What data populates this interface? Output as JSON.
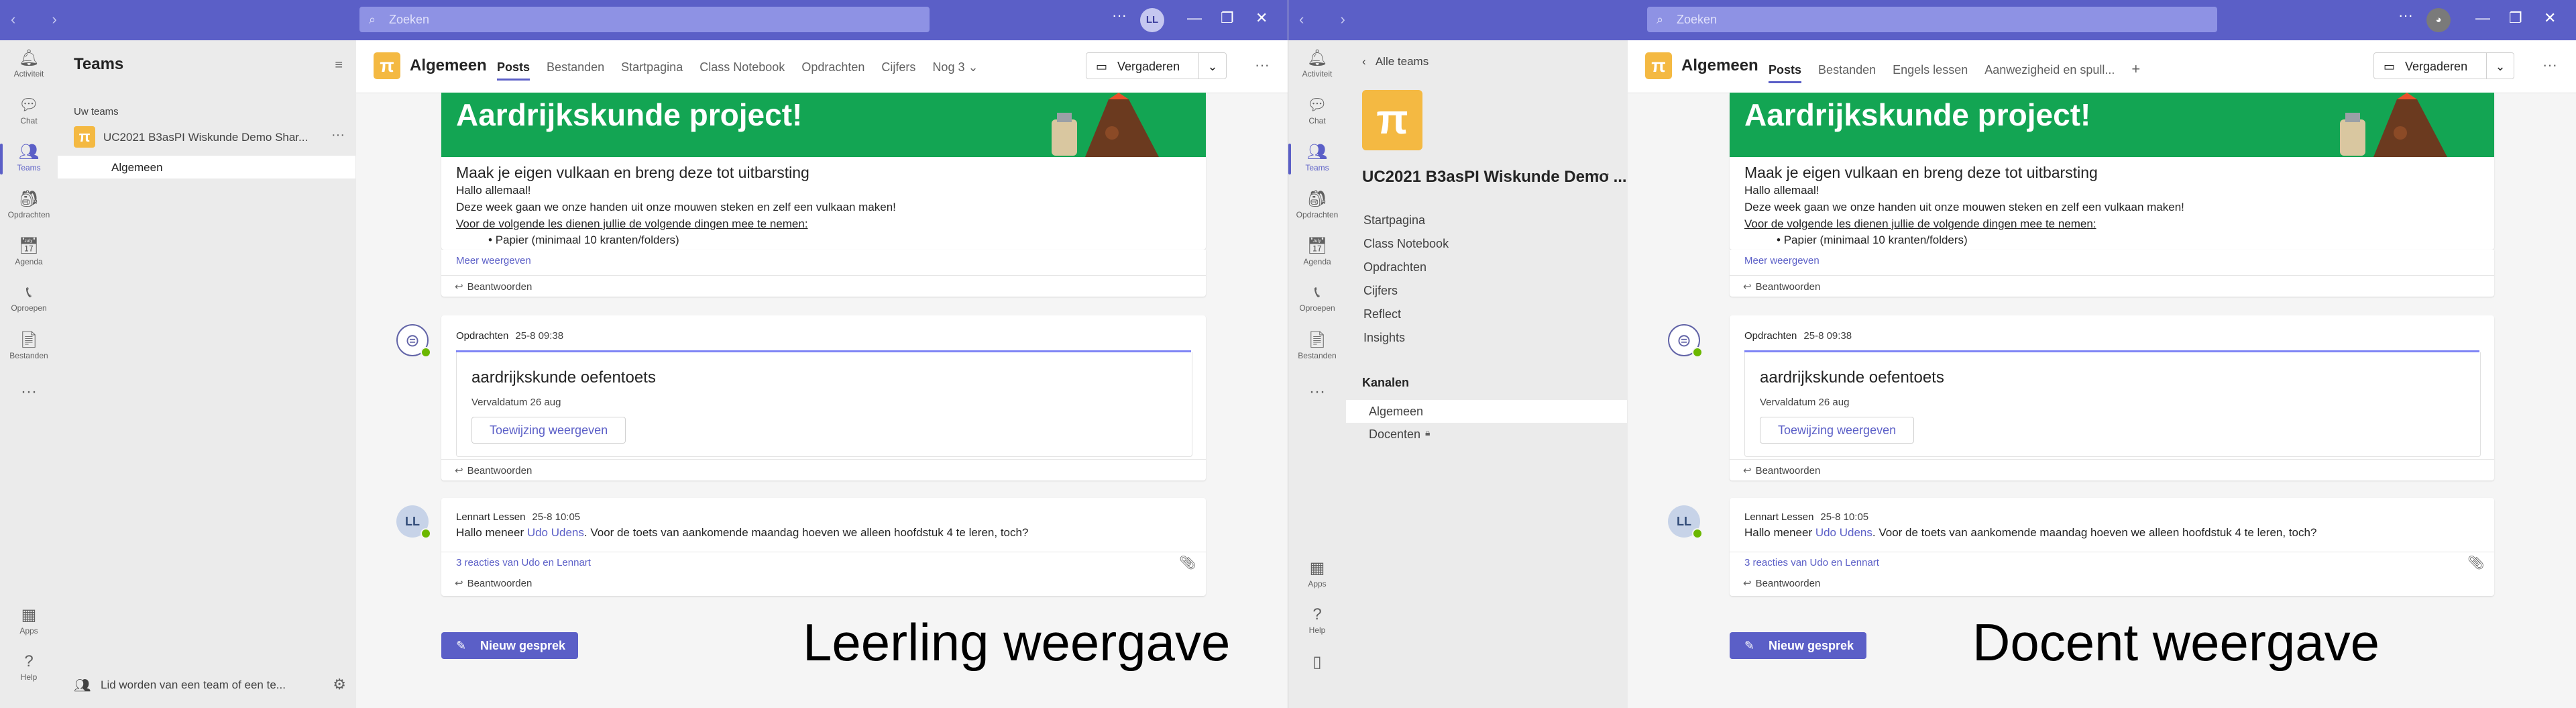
{
  "common": {
    "search_placeholder": "Zoeken",
    "search_icon": "search-icon",
    "avatar_initials": "LL",
    "rail": [
      {
        "label": "Activiteit",
        "icon": "bell-icon"
      },
      {
        "label": "Chat",
        "icon": "chat-icon"
      },
      {
        "label": "Teams",
        "icon": "teams-icon"
      },
      {
        "label": "Opdrachten",
        "icon": "assignments-icon"
      },
      {
        "label": "Agenda",
        "icon": "calendar-icon"
      },
      {
        "label": "Oproepen",
        "icon": "phone-icon"
      },
      {
        "label": "Bestanden",
        "icon": "file-icon"
      }
    ],
    "rail_more": "···",
    "rail_bottom": [
      {
        "label": "Apps",
        "icon": "apps-icon"
      },
      {
        "label": "Help",
        "icon": "help-icon"
      }
    ],
    "channel_title": "Algemeen",
    "meet_label": "Vergaderen",
    "banner_title": "Aardrijkskunde project!",
    "post": {
      "heading": "Maak je eigen vulkaan en breng deze tot uitbarsting",
      "line1": "Hallo allemaal!",
      "line2": "Deze week gaan we onze handen uit onze mouwen steken en zelf een vulkaan maken!",
      "line3": "Voor de volgende les dienen jullie de volgende dingen mee te nemen:",
      "bullet": "Papier (minimaal 10 kranten/folders)",
      "more": "Meer weergeven"
    },
    "reply_label": "Beantwoorden",
    "assignment": {
      "author": "Opdrachten",
      "time": "25-8 09:38",
      "title": "aardrijkskunde oefentoets",
      "due": "Vervaldatum 26 aug",
      "button": "Toewijzing weergeven"
    },
    "message": {
      "author": "Lennart Lessen",
      "time": "25-8 10:05",
      "text_before": "Hallo meneer ",
      "mention": "Udo Udens",
      "text_after": ". Voor de toets van aankomende maandag hoeven we alleen hoofdstuk 4 te leren, toch?",
      "reactions": "3 reacties van Udo en Lennart",
      "avatar": "LL"
    },
    "new_conversation": "Nieuw gesprek",
    "accent_color": "#5b5fc7",
    "banner_color": "#13a553",
    "team_logo_color": "#f4b942"
  },
  "left": {
    "teams_heading": "Teams",
    "group_label": "Uw teams",
    "team_name": "UC2021 B3asPI Wiskunde Demo Shar...",
    "channel": "Algemeen",
    "join_label": "Lid worden van een team of een te...",
    "tabs": [
      "Posts",
      "Bestanden",
      "Startpagina",
      "Class Notebook",
      "Opdrachten",
      "Cijfers",
      "Nog 3 ⌄"
    ],
    "caption": "Leerling weergave"
  },
  "right": {
    "back_label": "Alle teams",
    "team_name": "UC2021 B3asPI Wiskunde Demo ...",
    "nav": [
      "Startpagina",
      "Class Notebook",
      "Opdrachten",
      "Cijfers",
      "Reflect",
      "Insights"
    ],
    "channels_heading": "Kanalen",
    "channels": [
      "Algemeen",
      "Docenten"
    ],
    "tabs": [
      "Posts",
      "Bestanden",
      "Engels lessen",
      "Aanwezigheid en spull...",
      "+"
    ],
    "caption": "Docent weergave"
  }
}
